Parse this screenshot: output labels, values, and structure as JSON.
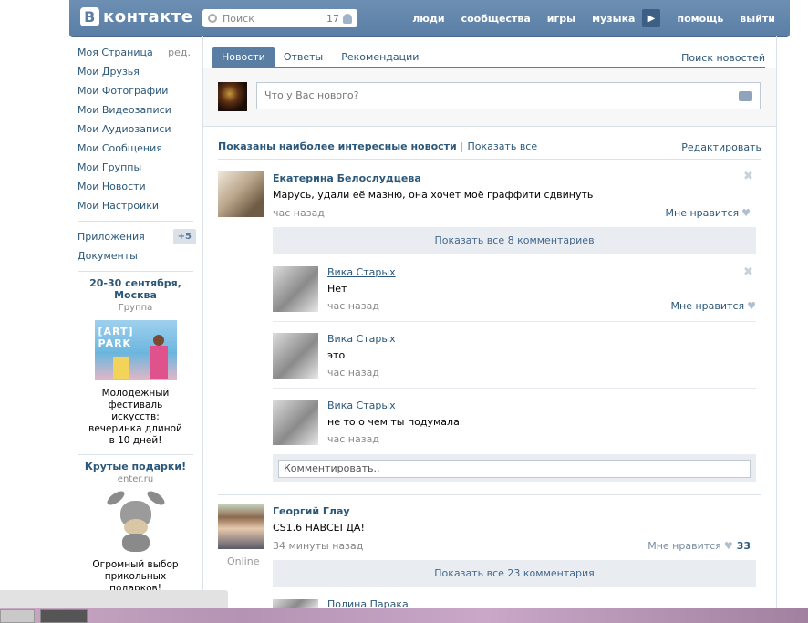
{
  "header": {
    "logo_letter": "В",
    "logo_text": "контакте",
    "search_placeholder": "Поиск",
    "search_count": "17",
    "nav": [
      "люди",
      "сообщества",
      "игры",
      "музыка",
      "помощь",
      "выйти"
    ]
  },
  "sidebar": {
    "items": [
      {
        "label": "Моя Страница",
        "extra": "ред."
      },
      {
        "label": "Мои Друзья"
      },
      {
        "label": "Мои Фотографии"
      },
      {
        "label": "Мои Видеозаписи"
      },
      {
        "label": "Мои Аудиозаписи"
      },
      {
        "label": "Мои Сообщения"
      },
      {
        "label": "Мои Группы"
      },
      {
        "label": "Мои Новости"
      },
      {
        "label": "Мои Настройки"
      }
    ],
    "apps": {
      "label": "Приложения",
      "badge": "+5"
    },
    "docs": {
      "label": "Документы"
    },
    "ad1": {
      "title": "20-30 сентября, Москва",
      "subtitle": "Группа",
      "image_text": "[ART] PARK",
      "desc": "Молодежный фестиваль искусств: вечеринка длиной в 10 дней!"
    },
    "ad2": {
      "title": "Крутые подарки!",
      "subtitle": "enter.ru",
      "desc": "Огромный выбор прикольных подарков!"
    }
  },
  "main": {
    "tabs": [
      "Новости",
      "Ответы",
      "Рекомендации"
    ],
    "search_news": "Поиск новостей",
    "composer_placeholder": "Что у Вас нового?",
    "filter_label": "Показаны наиболее интересные новости",
    "filter_showall": "Показать все",
    "edit": "Редактировать",
    "posts": [
      {
        "author": "Екатерина Белослудцева",
        "text": "Марусь, удали её мазню, она хочет моё граффити сдвинуть",
        "time": "час назад",
        "like": "Мне нравится",
        "show_comments": "Показать все 8 комментариев",
        "comments": [
          {
            "author": "Вика Старых",
            "text": "Нет",
            "time": "час назад",
            "like": "Мне нравится"
          },
          {
            "author": "Вика Старых",
            "text": "это",
            "time": "час назад"
          },
          {
            "author": "Вика Старых",
            "text": "не то о чем ты подумала",
            "time": "час назад"
          }
        ],
        "comment_placeholder": "Комментировать.."
      },
      {
        "author": "Георгий Глау",
        "text": "CS1.6 НАВСЕГДА!",
        "time": "34 минуты назад",
        "like": "Мне нравится",
        "like_count": "33",
        "online": "Online",
        "show_comments": "Показать все 23 комментария",
        "comments": [
          {
            "author": "Полина Парака"
          }
        ]
      }
    ]
  }
}
